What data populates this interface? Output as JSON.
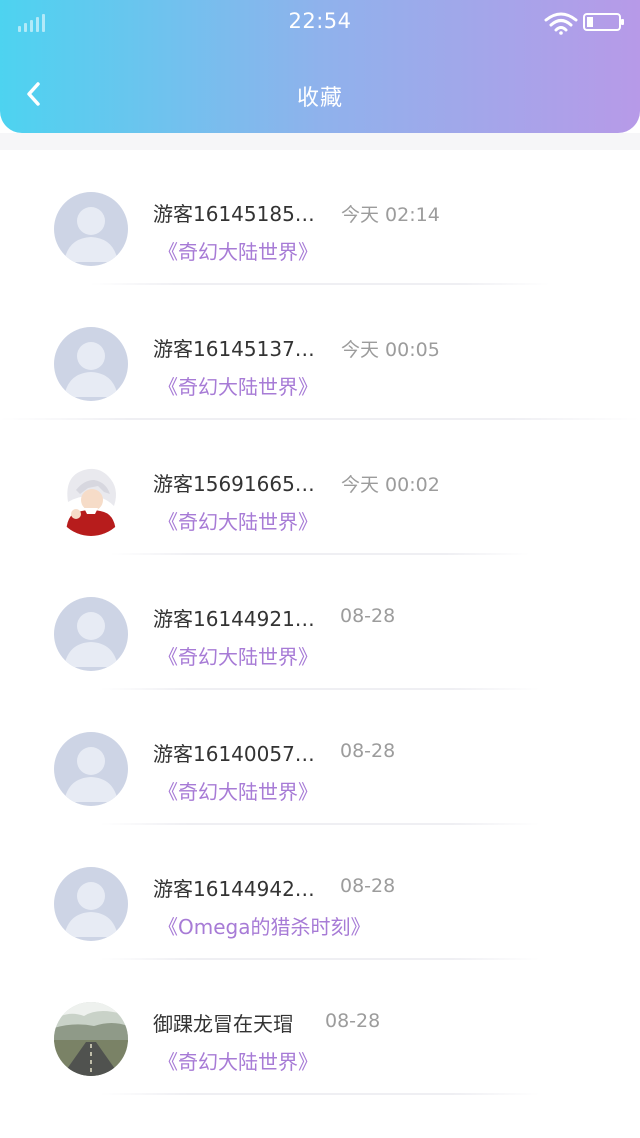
{
  "status_bar": {
    "time": "22:54"
  },
  "header": {
    "title": "收藏",
    "back_icon": "chevron-left-icon"
  },
  "items": [
    {
      "name": "游客16145185…",
      "time": "今天 02:14",
      "book": "《奇幻大陆世界》",
      "avatar": "default"
    },
    {
      "name": "游客16145137…",
      "time": "今天 00:05",
      "book": "《奇幻大陆世界》",
      "avatar": "default"
    },
    {
      "name": "游客15691665…",
      "time": "今天 00:02",
      "book": "《奇幻大陆世界》",
      "avatar": "anime"
    },
    {
      "name": "游客16144921…",
      "time": "08-28",
      "book": "《奇幻大陆世界》",
      "avatar": "default"
    },
    {
      "name": "游客16140057…",
      "time": "08-28",
      "book": "《奇幻大陆世界》",
      "avatar": "default"
    },
    {
      "name": "游客16144942…",
      "time": "08-28",
      "book": "《Omega的猎杀时刻》",
      "avatar": "default"
    },
    {
      "name": "御踝龙冒在天瑁",
      "time": "08-28",
      "book": "《奇幻大陆世界》",
      "avatar": "road"
    }
  ],
  "colors": {
    "gradient_start": "#4dd3f0",
    "gradient_end": "#b79ae8",
    "book_title": "#a77bd6",
    "timestamp": "#9c9c9c",
    "name": "#333333"
  }
}
